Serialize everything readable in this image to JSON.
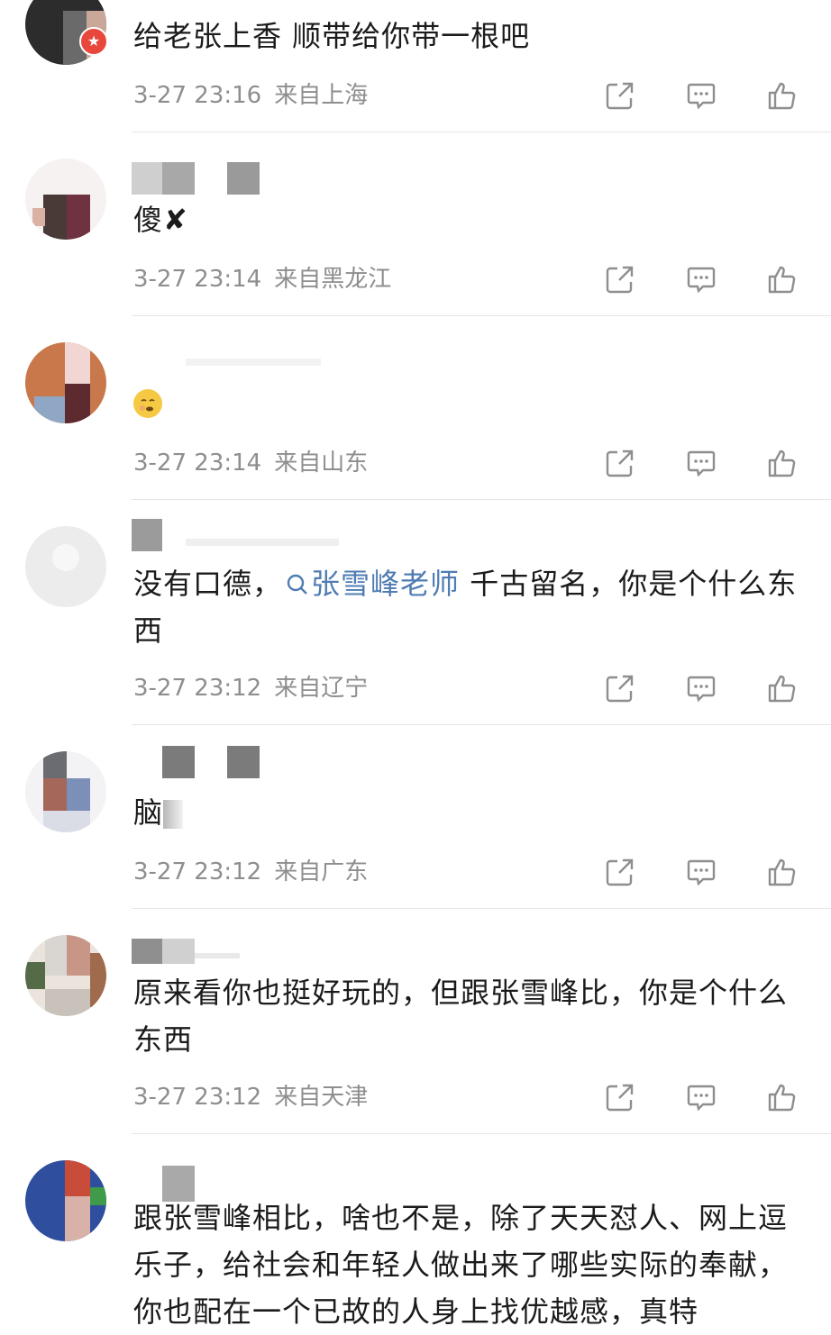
{
  "comments": [
    {
      "text": "给老张上香 顺带给你带一根吧",
      "time": "3-27 23:16",
      "location": "来自上海"
    },
    {
      "text": "傻✘",
      "time": "3-27 23:14",
      "location": "来自黑龙江"
    },
    {
      "text": "",
      "time": "3-27 23:14",
      "location": "来自山东",
      "emoji": "smirk-emoji"
    },
    {
      "text_pre": "没有口德，",
      "mention": "张雪峰老师",
      "text_post": " 千古留名，你是个什么东西",
      "time": "3-27 23:12",
      "location": "来自辽宁"
    },
    {
      "text": "脑",
      "time": "3-27 23:12",
      "location": "来自广东"
    },
    {
      "text": "原来看你也挺好玩的，但跟张雪峰比，你是个什么东西",
      "time": "3-27 23:12",
      "location": "来自天津"
    },
    {
      "text": "跟张雪峰相比，啥也不是，除了天天怼人、网上逗乐子，给社会和年轻人做出来了哪些实际的奉献，你也配在一个已故的人身上找优越感，真特",
      "time": "",
      "location": ""
    }
  ],
  "icons": {
    "share": "share-icon",
    "reply": "comment-icon",
    "like": "like-icon"
  },
  "colors": {
    "text": "#1b1b1b",
    "meta": "#8e8e8e",
    "mention": "#4f7cb3",
    "divider": "#e6e6e6"
  }
}
